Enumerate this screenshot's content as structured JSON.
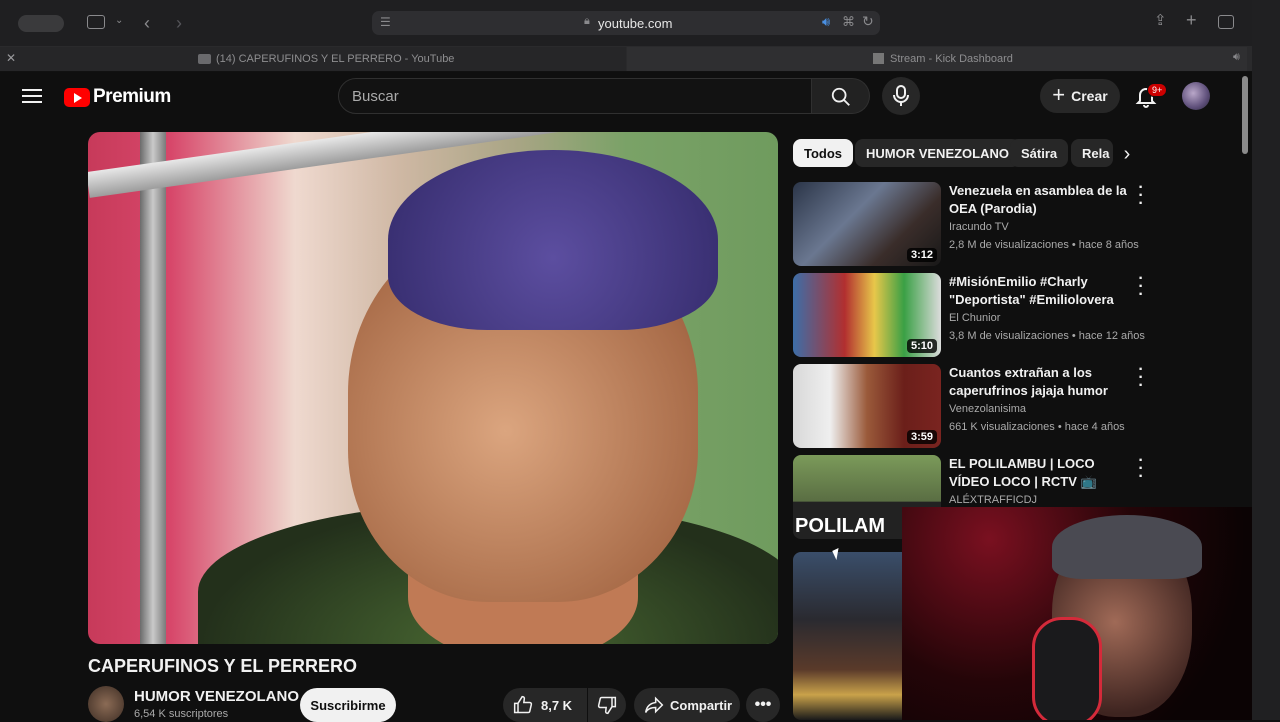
{
  "browser": {
    "url": "youtube.com",
    "tabs": [
      {
        "label": "(14) CAPERUFINOS Y EL PERRERO - YouTube"
      },
      {
        "label": "Stream - Kick Dashboard"
      }
    ]
  },
  "header": {
    "logo_text": "Premium",
    "search_placeholder": "Buscar",
    "create_label": "Crear",
    "notif_badge": "9+"
  },
  "video": {
    "title": "CAPERUFINOS Y EL PERRERO",
    "channel": "HUMOR VENEZOLANO",
    "subscribers": "6,54 K suscriptores",
    "subscribe_label": "Suscribirme",
    "likes": "8,7 K",
    "share_label": "Compartir"
  },
  "chips": [
    "Todos",
    "HUMOR VENEZOLANO",
    "Sátira",
    "Rela"
  ],
  "related": [
    {
      "title": "Venezuela en asamblea de la OEA (Parodia)",
      "channel": "Iracundo TV",
      "meta": "2,8 M de visualizaciones • hace 8 años",
      "duration": "3:12"
    },
    {
      "title": "#MisiónEmilio #Charly \"Deportista\" #Emiliolovera",
      "channel": "El Chunior",
      "meta": "3,8 M de visualizaciones • hace 12 años",
      "duration": "5:10"
    },
    {
      "title": "Cuantos extrañan a los caperufrinos jajaja humor que ...",
      "channel": "Venezolanisima",
      "meta": "661 K visualizaciones • hace 4 años",
      "duration": "3:59"
    },
    {
      "title": "EL POLILAMBU | LOCO VÍDEO LOCO | RCTV 📺",
      "channel": "ALÉXTRAFFICDJ",
      "meta": "",
      "duration": ""
    },
    {
      "title": "",
      "channel": "",
      "meta": "",
      "duration": ""
    }
  ],
  "thumb_text": "POLILAM",
  "colors": {
    "accent": "#ff0000",
    "background": "#0f0f0f",
    "chip_active": "#f1f1f1"
  }
}
